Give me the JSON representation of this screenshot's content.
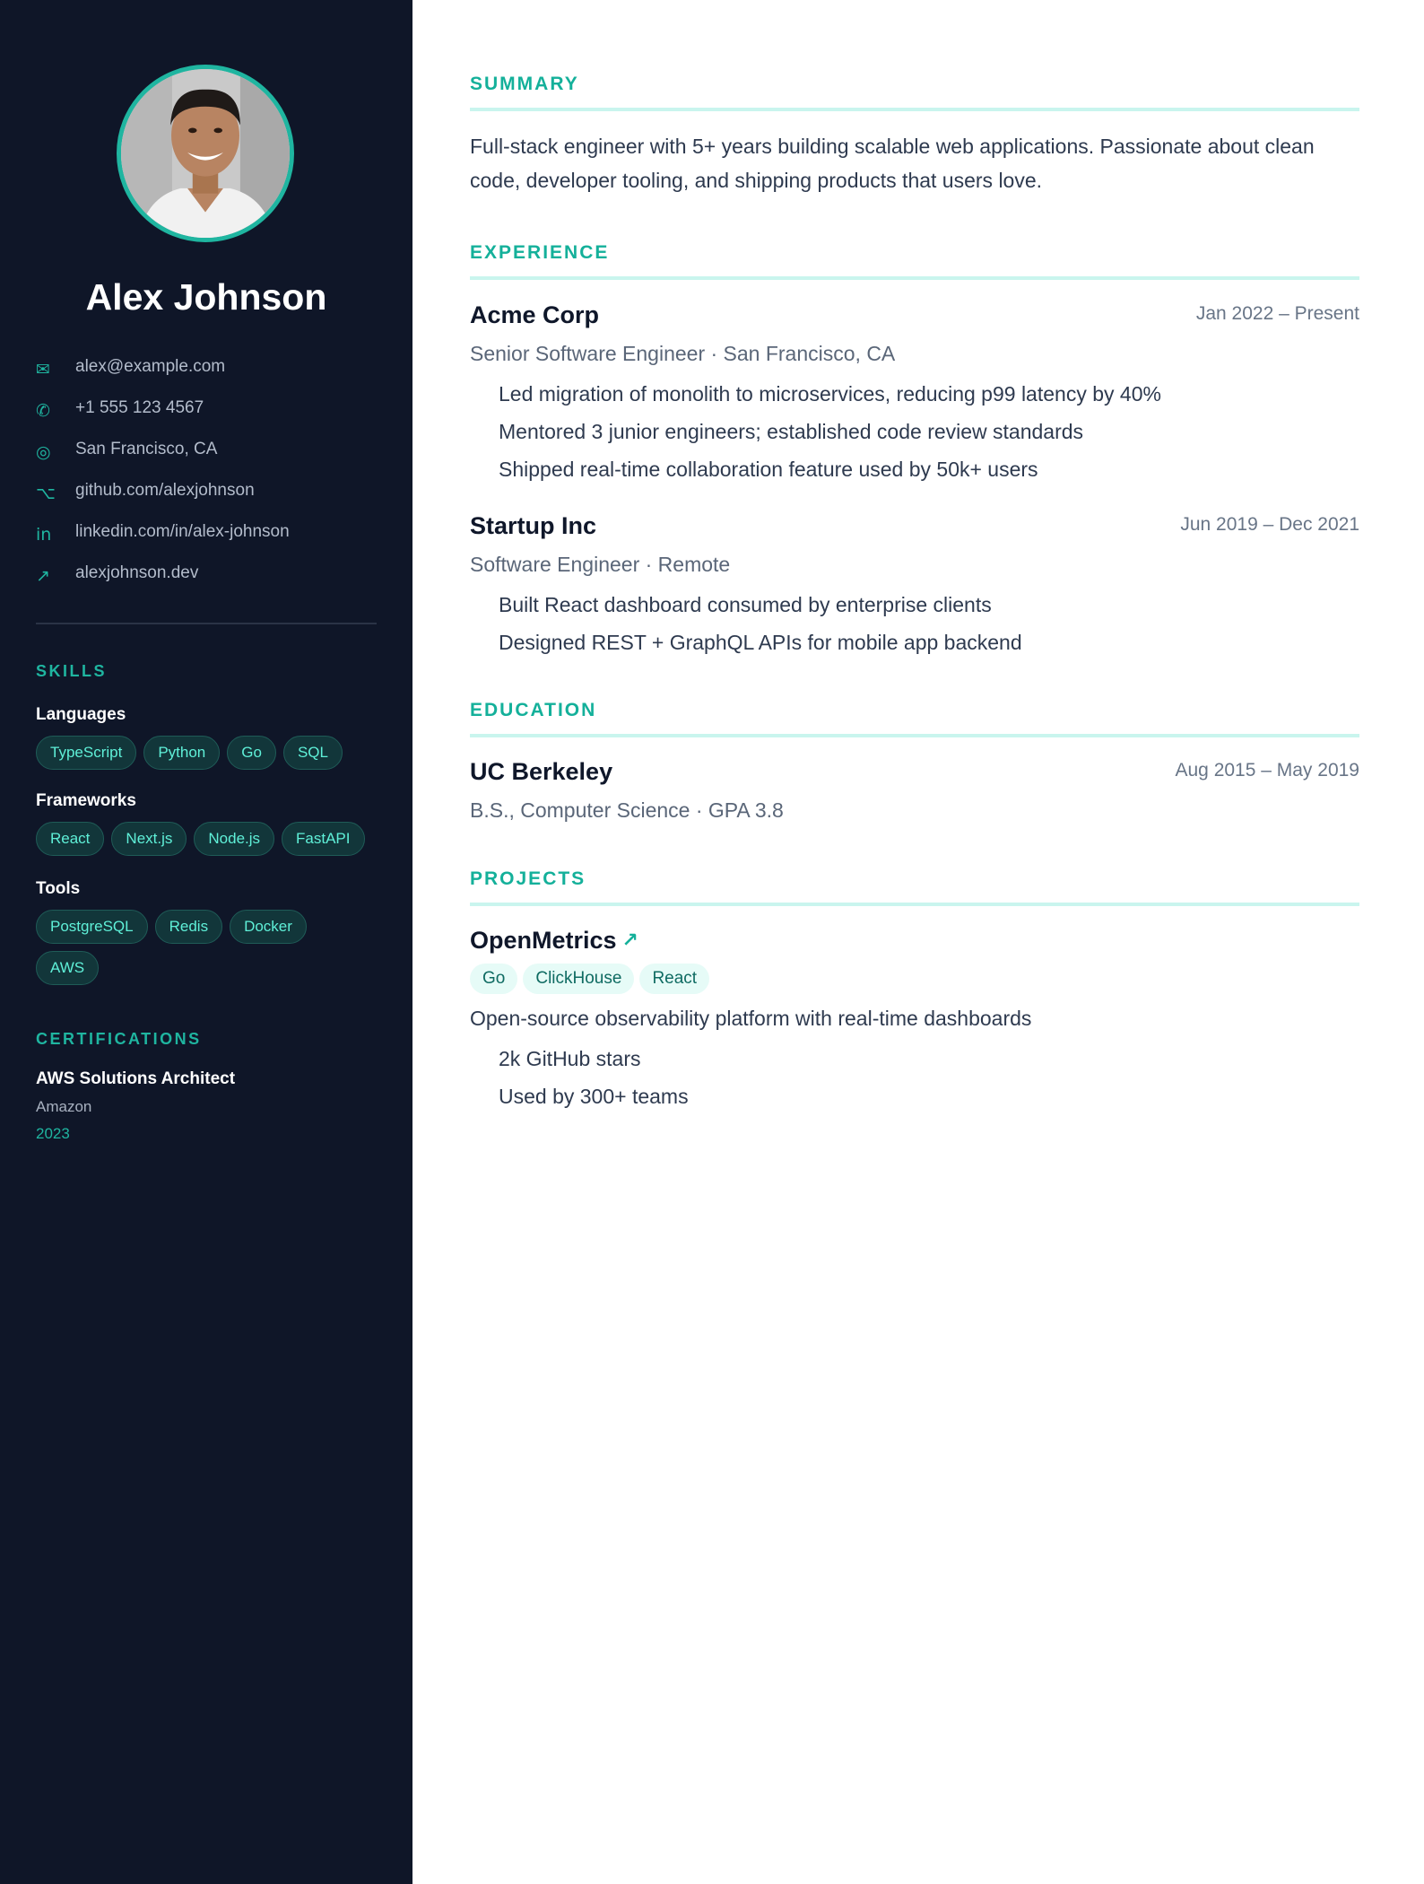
{
  "profile": {
    "name": "Alex Johnson",
    "contacts": [
      {
        "icon": "mail-icon",
        "glyph": "✉",
        "text": "alex@example.com"
      },
      {
        "icon": "phone-icon",
        "glyph": "✆",
        "text": "+1 555 123 4567"
      },
      {
        "icon": "location-icon",
        "glyph": "◎",
        "text": "San Francisco, CA"
      },
      {
        "icon": "github-icon",
        "glyph": "⌥",
        "text": "github.com/alexjohnson"
      },
      {
        "icon": "linkedin-icon",
        "glyph": "in",
        "text": "linkedin.com/in/alex-johnson"
      },
      {
        "icon": "external-link-icon",
        "glyph": "↗",
        "text": "alexjohnson.dev"
      }
    ]
  },
  "skills": {
    "heading": "SKILLS",
    "groups": [
      {
        "title": "Languages",
        "items": [
          "TypeScript",
          "Python",
          "Go",
          "SQL"
        ]
      },
      {
        "title": "Frameworks",
        "items": [
          "React",
          "Next.js",
          "Node.js",
          "FastAPI"
        ]
      },
      {
        "title": "Tools",
        "items": [
          "PostgreSQL",
          "Redis",
          "Docker",
          "AWS"
        ]
      }
    ]
  },
  "certifications": {
    "heading": "CERTIFICATIONS",
    "items": [
      {
        "name": "AWS Solutions Architect",
        "issuer": "Amazon",
        "year": "2023"
      }
    ]
  },
  "summary": {
    "heading": "SUMMARY",
    "text": "Full-stack engineer with 5+ years building scalable web applications. Passionate about clean code, developer tooling, and shipping products that users love."
  },
  "experience": {
    "heading": "EXPERIENCE",
    "jobs": [
      {
        "company": "Acme Corp",
        "date": "Jan 2022 – Present",
        "role": "Senior Software Engineer · San Francisco, CA",
        "bullets": [
          "Led migration of monolith to microservices, reducing p99 latency by 40%",
          "Mentored 3 junior engineers; established code review standards",
          "Shipped real-time collaboration feature used by 50k+ users"
        ]
      },
      {
        "company": "Startup Inc",
        "date": "Jun 2019 – Dec 2021",
        "role": "Software Engineer · Remote",
        "bullets": [
          "Built React dashboard consumed by enterprise clients",
          "Designed REST + GraphQL APIs for mobile app backend"
        ]
      }
    ]
  },
  "education": {
    "heading": "EDUCATION",
    "items": [
      {
        "school": "UC Berkeley",
        "date": "Aug 2015 – May 2019",
        "degree": "B.S., Computer Science · GPA 3.8"
      }
    ]
  },
  "projects": {
    "heading": "PROJECTS",
    "items": [
      {
        "name": "OpenMetrics",
        "link_glyph": "↗",
        "tags": [
          "Go",
          "ClickHouse",
          "React"
        ],
        "description": "Open-source observability platform with real-time dashboards",
        "bullets": [
          "2k GitHub stars",
          "Used by 300+ teams"
        ]
      }
    ]
  },
  "colors": {
    "sidebar_bg": "#0f1628",
    "accent": "#1fb5a0",
    "chip_text": "#5ff0d8",
    "heading_rule": "#c9f5ee"
  }
}
